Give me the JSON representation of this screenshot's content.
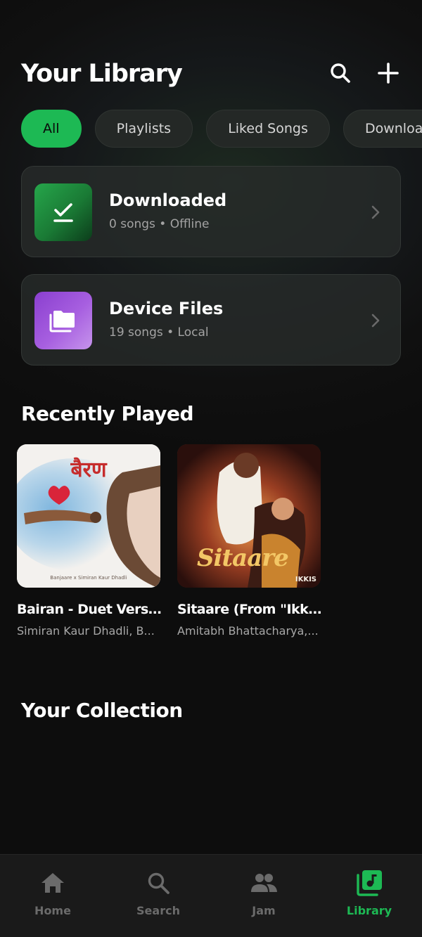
{
  "header": {
    "title": "Your Library"
  },
  "filters": [
    "All",
    "Playlists",
    "Liked Songs",
    "Downloaded"
  ],
  "cards": [
    {
      "title": "Downloaded",
      "subtitle": "0 songs • Offline"
    },
    {
      "title": "Device Files",
      "subtitle": "19 songs • Local"
    }
  ],
  "recently_played": {
    "title": "Recently Played",
    "items": [
      {
        "title": "Bairan - Duet Version",
        "artist": "Simiran Kaur Dhadli, B...",
        "art_text": "बैरण",
        "art_credit": "Banjaare x Simiran Kaur Dhadli"
      },
      {
        "title": "Sitaare (From \"Ikkis\")",
        "artist": "Amitabh Bhattacharya,...",
        "art_text": "Sitaare",
        "art_badge": "IKKIS"
      }
    ]
  },
  "collection": {
    "title": "Your Collection"
  },
  "nav": [
    {
      "label": "Home",
      "icon": "home-icon"
    },
    {
      "label": "Search",
      "icon": "search-icon"
    },
    {
      "label": "Jam",
      "icon": "people-icon"
    },
    {
      "label": "Library",
      "icon": "library-icon",
      "active": true
    }
  ],
  "colors": {
    "accent": "#1db954",
    "background": "#101010"
  }
}
